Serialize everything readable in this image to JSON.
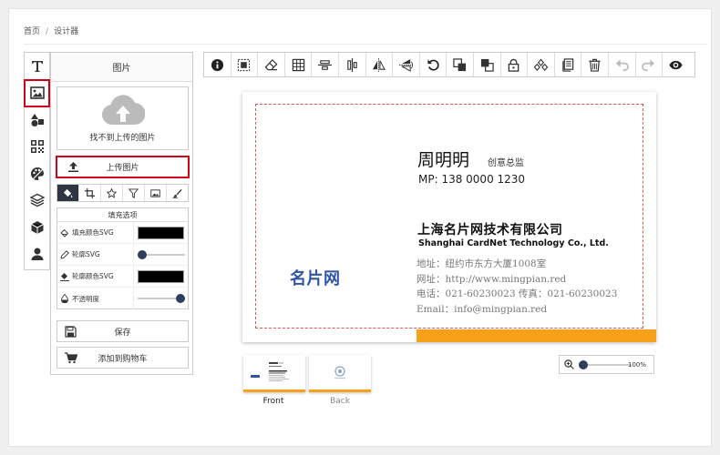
{
  "breadcrumb": {
    "home": "首页",
    "separator": "/",
    "current": "设计器"
  },
  "rail": {
    "items": [
      {
        "name": "text",
        "icon": "text-icon"
      },
      {
        "name": "image",
        "icon": "image-icon",
        "active": true
      },
      {
        "name": "shapes",
        "icon": "shapes-icon"
      },
      {
        "name": "qrcode",
        "icon": "qrcode-icon"
      },
      {
        "name": "background",
        "icon": "palette-icon"
      },
      {
        "name": "layers",
        "icon": "layers-icon"
      },
      {
        "name": "templates",
        "icon": "cube-icon"
      },
      {
        "name": "user",
        "icon": "user-icon"
      }
    ]
  },
  "panel": {
    "title": "图片",
    "no_image_text": "找不到上传的图片",
    "upload_label": "上传图片",
    "fill_header": "填充选项",
    "fill_color_label": "填充颜色SVG",
    "outline_label": "轮廓SVG",
    "outline_color_label": "轮廓颜色SVG",
    "opacity_label": "不透明度",
    "fill_color": "#000000",
    "outline_color": "#000000",
    "outline_width_value": 0,
    "opacity_value": 1,
    "save_label": "保存",
    "cart_label": "添加到购物车"
  },
  "toolbar": {
    "buttons": [
      "info-icon",
      "select-all-icon",
      "eraser-icon",
      "grid-icon",
      "align-vertical-icon",
      "align-horizontal-icon",
      "flip-horizontal-icon",
      "flip-vertical-icon",
      "rotate-icon",
      "bring-forward-icon",
      "send-backward-icon",
      "lock-icon",
      "group-icon",
      "duplicate-icon",
      "delete-icon",
      "undo-icon",
      "redo-icon",
      "preview-icon"
    ]
  },
  "card": {
    "name": "周明明",
    "title": "创意总监",
    "phone": "MP: 138 0000 1230",
    "company": "上海名片网技术有限公司",
    "company_en": "Shanghai CardNet Technology Co., Ltd.",
    "address": "地址：纽约市东方大厦1008室",
    "website": "网址：http://www.mingpian.red",
    "tel": "电话：021-60230023  传真：021-60230023",
    "email": "Email：info@mingpian.red",
    "logo_text": "名片网",
    "accent_color": "#f7a01a",
    "logo_color": "#2e55a5"
  },
  "zoom": {
    "value": "100%"
  },
  "thumbnails": {
    "front": "Front",
    "back": "Back"
  }
}
